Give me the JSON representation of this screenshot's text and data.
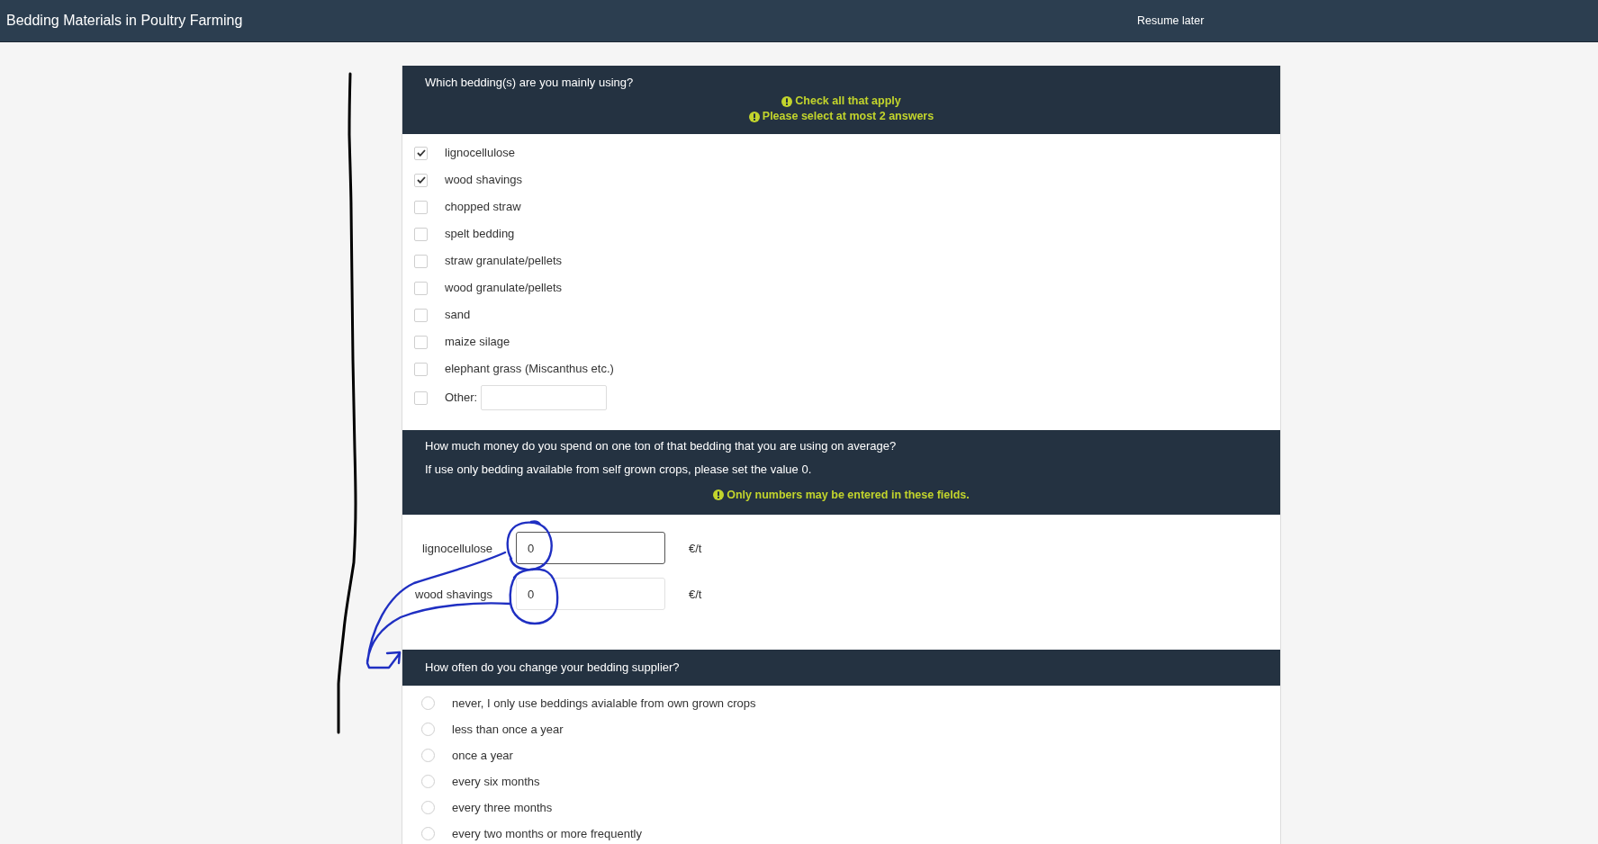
{
  "top_bar": {
    "title": "Bedding Materials in Poultry Farming",
    "resume_button": "Resume later"
  },
  "questions": [
    {
      "kind": "checkbox",
      "title": "Which bedding(s) are you mainly using?",
      "tips": [
        "Check all that apply",
        "Please select at most 2 answers"
      ],
      "options": [
        {
          "label": "lignocellulose",
          "checked": true
        },
        {
          "label": "wood shavings",
          "checked": true
        },
        {
          "label": "chopped straw",
          "checked": false
        },
        {
          "label": "spelt bedding",
          "checked": false
        },
        {
          "label": "straw granulate/pellets",
          "checked": false
        },
        {
          "label": "wood granulate/pellets",
          "checked": false
        },
        {
          "label": "sand",
          "checked": false
        },
        {
          "label": "maize silage",
          "checked": false
        },
        {
          "label": "elephant grass (Miscanthus etc.)",
          "checked": false
        }
      ],
      "other": {
        "label": "Other:",
        "checked": false
      }
    },
    {
      "kind": "numbers",
      "title": "How much money do you spend on one ton of that bedding that you are using on average?",
      "help": "If use only bedding available from self grown crops, please set the value 0.",
      "tips": [
        "Only numbers may be entered in these fields."
      ],
      "fields": [
        {
          "label": "lignocellulose",
          "value": "0",
          "unit": "€/t",
          "focused": true
        },
        {
          "label": "wood shavings",
          "value": "0",
          "unit": "€/t",
          "focused": false
        }
      ]
    },
    {
      "kind": "radio",
      "title": "How often do you change your bedding supplier?",
      "options": [
        {
          "label": "never, I only use beddings avialable from own grown crops",
          "selected": false
        },
        {
          "label": "less than once a year",
          "selected": false
        },
        {
          "label": "once a year",
          "selected": false
        },
        {
          "label": "every six months",
          "selected": false
        },
        {
          "label": "every three months",
          "selected": false
        },
        {
          "label": "every two months or more frequently",
          "selected": false
        }
      ]
    }
  ]
}
